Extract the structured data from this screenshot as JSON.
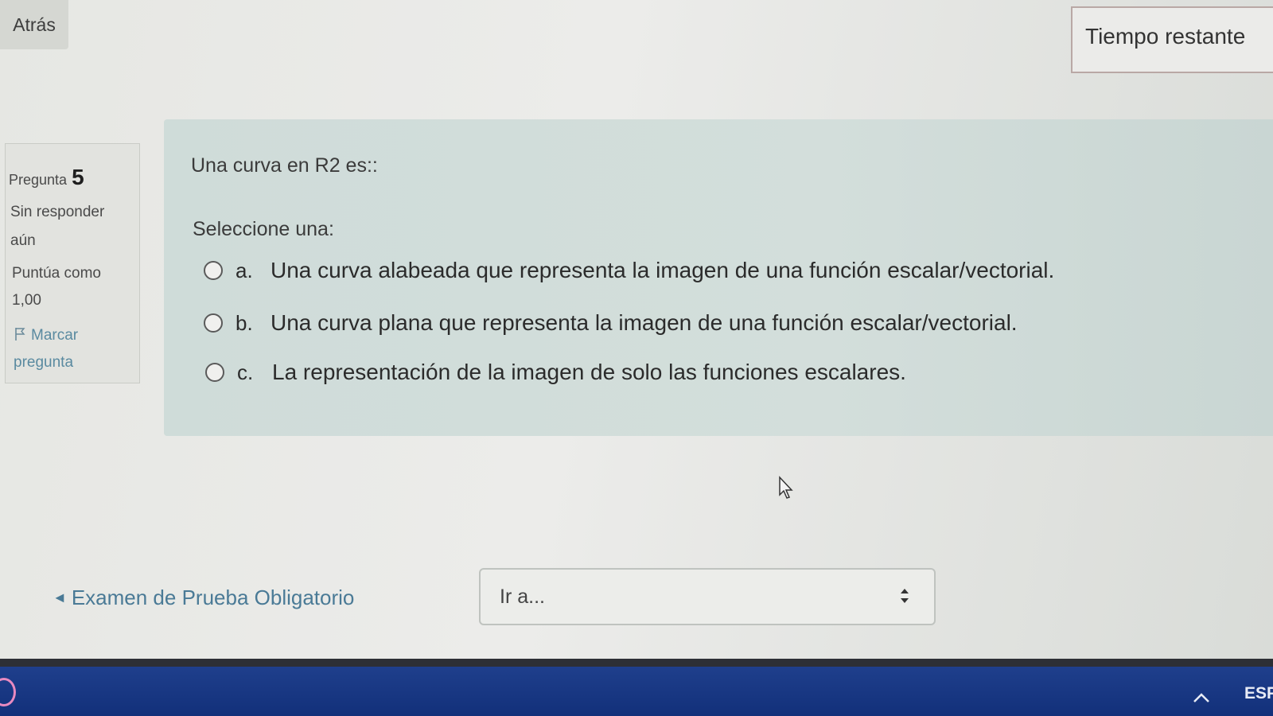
{
  "header": {
    "back_label": "Atrás",
    "timer_label": "Tiempo restante"
  },
  "question_info": {
    "label": "Pregunta",
    "number": "5",
    "status": "Sin responder aún",
    "grade": "Puntúa como 1,00",
    "flag_label": "Marcar pregunta"
  },
  "question": {
    "text": "Una curva en R2 es::",
    "prompt": "Seleccione una:",
    "options": [
      {
        "letter": "a.",
        "text": "Una curva alabeada que representa la imagen de una función escalar/vectorial."
      },
      {
        "letter": "b.",
        "text": "Una curva plana que representa la imagen de una función escalar/vectorial."
      },
      {
        "letter": "c.",
        "text": "La representación de la imagen de solo las funciones escalares."
      }
    ]
  },
  "footer": {
    "prev_link": "Examen de Prueba Obligatorio",
    "prev_link_arrow": "◄",
    "jump_placeholder": "Ir a..."
  },
  "taskbar": {
    "language": "ESP"
  },
  "colors": {
    "link": "#4a7a96",
    "taskbar": "#12307a",
    "question_bg": "#cfdcd9"
  }
}
